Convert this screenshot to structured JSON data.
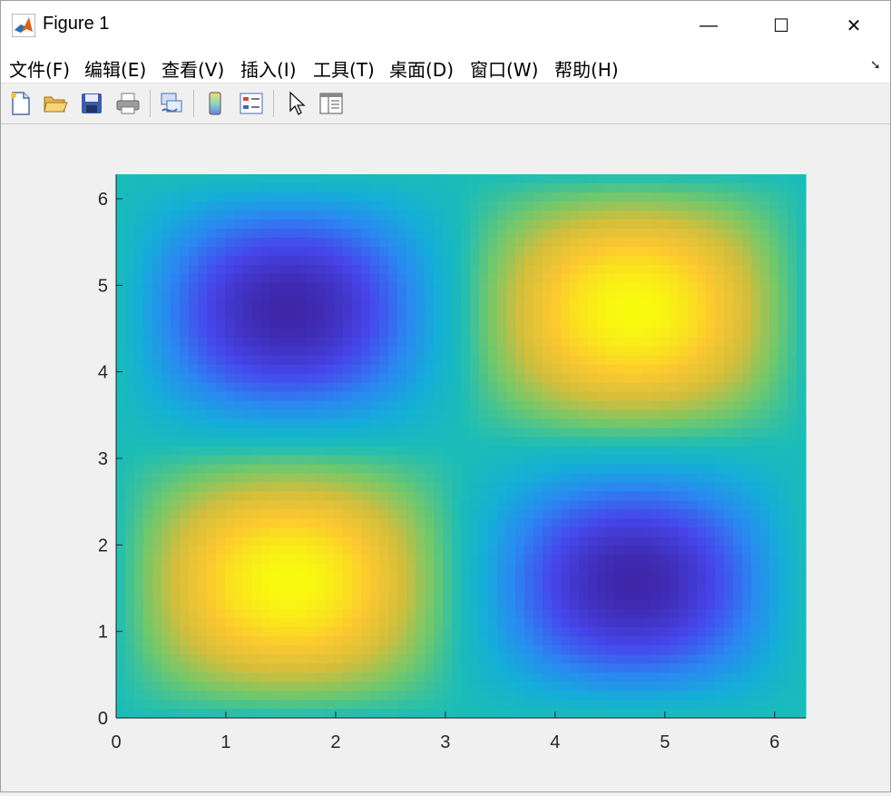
{
  "window": {
    "title": "Figure 1",
    "controls": {
      "minimize": "—",
      "maximize": "☐",
      "close": "✕"
    }
  },
  "menubar": {
    "items": [
      {
        "label": "文件(F)"
      },
      {
        "label": "编辑(E)"
      },
      {
        "label": "查看(V)"
      },
      {
        "label": "插入(I)"
      },
      {
        "label": "工具(T)"
      },
      {
        "label": "桌面(D)"
      },
      {
        "label": "窗口(W)"
      },
      {
        "label": "帮助(H)"
      }
    ],
    "corner_icon": "dock-arrow-icon"
  },
  "toolbar": {
    "buttons": [
      {
        "icon": "new-figure-icon"
      },
      {
        "icon": "open-folder-icon"
      },
      {
        "icon": "save-icon"
      },
      {
        "icon": "print-icon"
      },
      {
        "icon": "link-plot-icon"
      },
      {
        "icon": "colorbar-icon"
      },
      {
        "icon": "legend-icon"
      },
      {
        "icon": "pointer-icon"
      },
      {
        "icon": "property-inspector-icon"
      }
    ]
  },
  "colors": {
    "low": "#3e26a8",
    "mid": "#1ab9b9",
    "high": "#f9fb0e"
  },
  "chart_data": {
    "type": "heatmap",
    "function": "sin(x)*cos(y - pi/2)",
    "colormap": "parula",
    "x_range": [
      0,
      6.2832
    ],
    "y_range": [
      0,
      6.2832
    ],
    "xlim": [
      0,
      6.2832
    ],
    "ylim": [
      0,
      6.2832
    ],
    "x_ticks": [
      "0",
      "1",
      "2",
      "3",
      "4",
      "5",
      "6"
    ],
    "y_ticks": [
      "0",
      "1",
      "2",
      "3",
      "4",
      "5",
      "6"
    ],
    "peaks": [
      {
        "x": 1.5708,
        "y": 1.5708,
        "value": 1
      },
      {
        "x": 4.7124,
        "y": 4.7124,
        "value": 1
      }
    ],
    "troughs": [
      {
        "x": 4.7124,
        "y": 1.5708,
        "value": -1
      },
      {
        "x": 1.5708,
        "y": 4.7124,
        "value": -1
      }
    ],
    "grid": false,
    "title": "",
    "xlabel": "",
    "ylabel": ""
  }
}
